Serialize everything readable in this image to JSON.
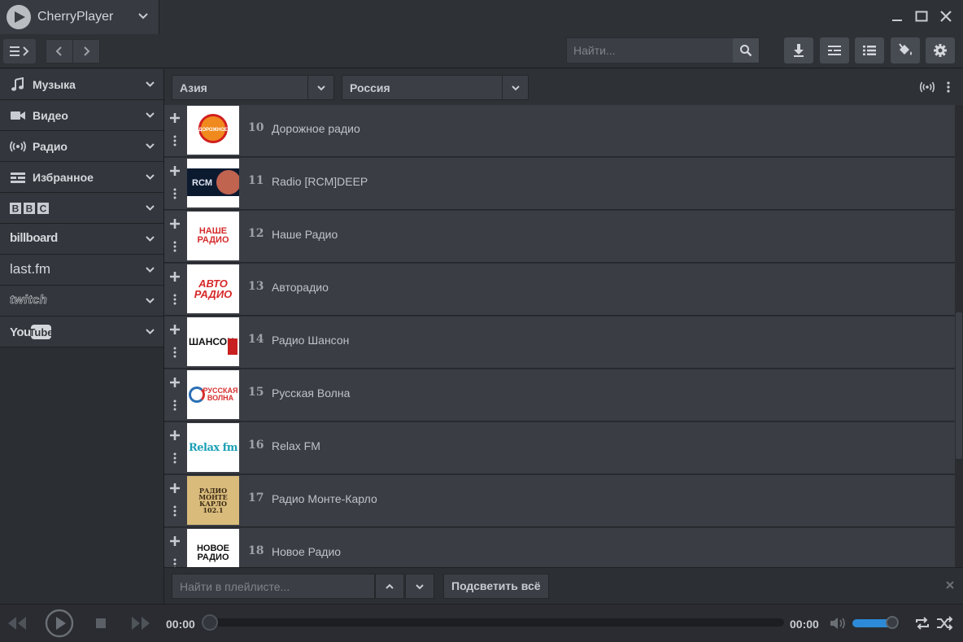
{
  "app": {
    "title": "CherryPlayer"
  },
  "toolbar": {
    "search_placeholder": "Найти..."
  },
  "sidebar": {
    "items": [
      {
        "label": "Музыка",
        "icon": "music-icon"
      },
      {
        "label": "Видео",
        "icon": "video-icon"
      },
      {
        "label": "Радио",
        "icon": "radio-icon"
      },
      {
        "label": "Избранное",
        "icon": "favorites-icon"
      },
      {
        "label": "BBC",
        "icon": "bbc-logo"
      },
      {
        "label": "billboard",
        "icon": "billboard-logo"
      },
      {
        "label": "last.fm",
        "icon": "lastfm-logo"
      },
      {
        "label": "twitch",
        "icon": "twitch-logo"
      },
      {
        "label": "YouTube",
        "icon": "youtube-logo"
      }
    ]
  },
  "filters": {
    "region": "Азия",
    "country": "Россия"
  },
  "stations": [
    {
      "num": "10",
      "name": "Дорожное радио",
      "logo": "ДОРОЖНОЕ",
      "logo_color": "#e23a1d"
    },
    {
      "num": "11",
      "name": "Radio [RCM]DEEP",
      "logo": "RCM",
      "logo_color": "#ffffff"
    },
    {
      "num": "12",
      "name": "Наше Радио",
      "logo": "НАШЕ РАДИО",
      "logo_color": "#d52b2b"
    },
    {
      "num": "13",
      "name": "Авторадио",
      "logo": "АВТО РАДИО",
      "logo_color": "#1d6fb8"
    },
    {
      "num": "14",
      "name": "Радио Шансон",
      "logo": "ШАНСОН",
      "logo_color": "#111111"
    },
    {
      "num": "15",
      "name": "Русская Волна",
      "logo": "РУССКАЯ ВОЛНА",
      "logo_color": "#d6302f"
    },
    {
      "num": "16",
      "name": "Relax FM",
      "logo": "Relax fm",
      "logo_color": "#1aa0b5"
    },
    {
      "num": "17",
      "name": "Радио Монте-Карло",
      "logo": "РАДИО МОНТЕ КАРЛО 102.1",
      "logo_color": "#3a2a14"
    },
    {
      "num": "18",
      "name": "Новое Радио",
      "logo": "НОВОЕ РАДИО",
      "logo_color": "#111111"
    }
  ],
  "playlist_bar": {
    "search_placeholder": "Найти в плейлисте...",
    "highlight_all": "Подсветить всё"
  },
  "player": {
    "current_time": "00:00",
    "total_time": "00:00",
    "progress": 0.0,
    "volume": 0.85
  },
  "colors": {
    "accent": "#2d8ad8",
    "background": "#2b2e33",
    "row": "#3a3d43"
  }
}
